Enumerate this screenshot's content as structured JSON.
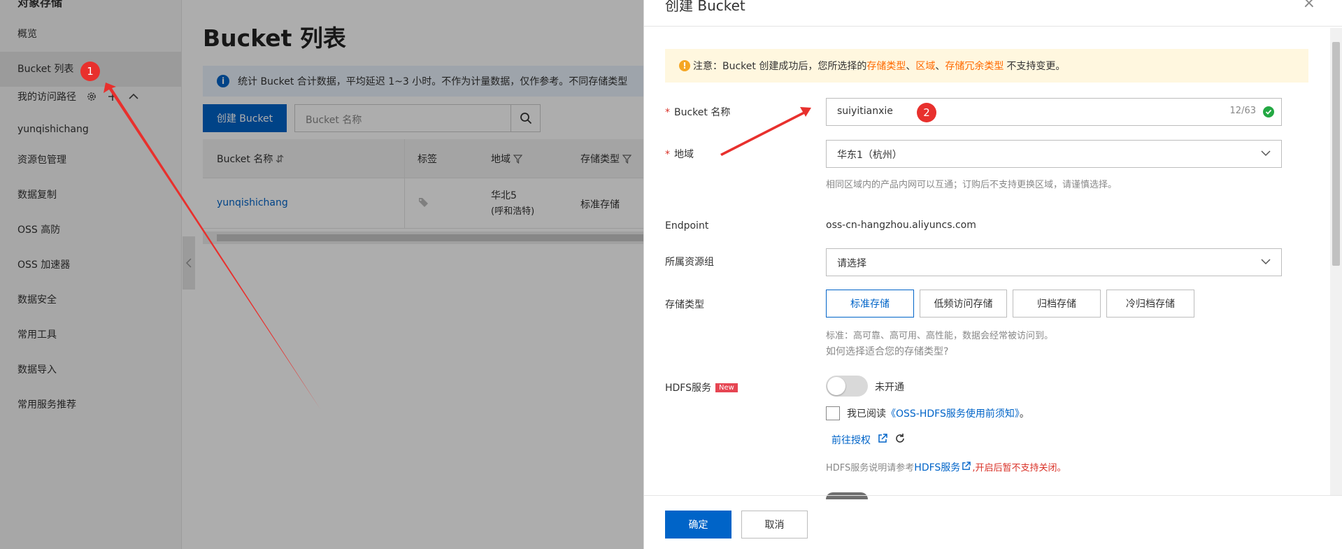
{
  "sidebar": {
    "heading": "对象存储",
    "items": [
      {
        "label": "概览"
      },
      {
        "label": "Bucket 列表"
      },
      {
        "label": "yunqishichang"
      },
      {
        "label": "资源包管理"
      },
      {
        "label": "数据复制"
      },
      {
        "label": "OSS 高防"
      },
      {
        "label": "OSS 加速器"
      },
      {
        "label": "数据安全"
      },
      {
        "label": "常用工具"
      },
      {
        "label": "数据导入"
      },
      {
        "label": "常用服务推荐"
      }
    ],
    "access_path_label": "我的访问路径"
  },
  "main": {
    "title": "Bucket 列表",
    "info_text": "统计 Bucket 合计数据，平均延迟 1~3 小时。不作为计量数据，仅作参考。不同存储类型",
    "create_button": "创建 Bucket",
    "search_placeholder": "Bucket 名称",
    "table": {
      "headers": [
        "Bucket 名称",
        "标签",
        "地域",
        "存储类型"
      ],
      "rows": [
        {
          "name": "yunqishichang",
          "region_line1": "华北5",
          "region_line2": "(呼和浩特)",
          "storage": "标准存储"
        }
      ]
    }
  },
  "drawer": {
    "title": "创建 Bucket",
    "warning": {
      "prefix": "注意：Bucket 创建成功后，您所选择的",
      "highlight1": "存储类型",
      "sep1": "、",
      "highlight2": "区域",
      "sep2": "、",
      "highlight3": "存储冗余类型",
      "suffix": "不支持变更。"
    },
    "bucket_name": {
      "label": "Bucket 名称",
      "value": "suiyitianxie",
      "counter": "12/63"
    },
    "region": {
      "label": "地域",
      "value": "华东1（杭州）",
      "help": "相同区域内的产品内网可以互通；订购后不支持更换区域，请谨慎选择。"
    },
    "endpoint": {
      "label": "Endpoint",
      "value": "oss-cn-hangzhou.aliyuncs.com"
    },
    "resource_group": {
      "label": "所属资源组",
      "placeholder": "请选择"
    },
    "storage_type": {
      "label": "存储类型",
      "options": [
        "标准存储",
        "低频访问存储",
        "归档存储",
        "冷归档存储"
      ],
      "selected": "标准存储",
      "help": "标准：高可靠、高可用、高性能，数据会经常被访问到。",
      "help_link": "如何选择适合您的存储类型?"
    },
    "hdfs": {
      "label": "HDFS服务",
      "badge": "New",
      "toggle_text": "未开通",
      "checkbox_prefix": "我已阅读",
      "checkbox_link": "《OSS-HDFS服务使用前须知》",
      "checkbox_suffix": "。",
      "auth_link": "前往授权",
      "note_prefix": "HDFS服务说明请参考",
      "note_link": "HDFS服务",
      "note_warning": ",开启后暂不支持关闭。"
    },
    "confirm_button": "确定",
    "cancel_button": "取消"
  },
  "annotations": {
    "marker1": "1",
    "marker2": "2",
    "color": "#e8302d"
  }
}
